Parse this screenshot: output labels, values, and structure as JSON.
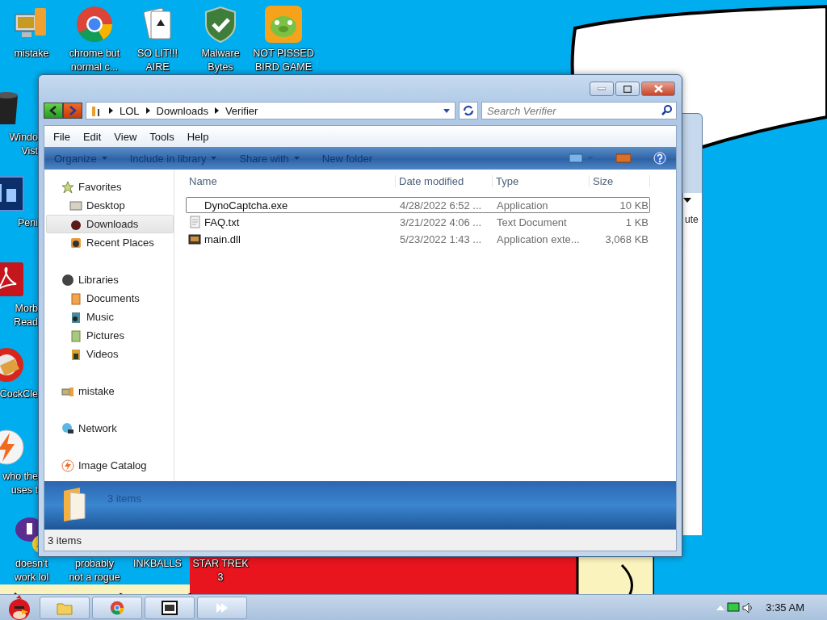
{
  "desktop_icons": [
    {
      "kind": "computer",
      "lines": [
        "mistake"
      ]
    },
    {
      "kind": "chrome",
      "lines": [
        "chrome but",
        "normal c..."
      ]
    },
    {
      "kind": "cards",
      "lines": [
        "SO LIT!!!",
        "AIRE"
      ]
    },
    {
      "kind": "shield",
      "lines": [
        "Malware",
        "Bytes"
      ]
    },
    {
      "kind": "pig",
      "lines": [
        "NOT PISSED",
        "BIRD GAME"
      ]
    },
    {
      "kind": "bin",
      "lines": [
        "Windo",
        "Vist"
      ]
    },
    {
      "kind": "ps",
      "lines": [
        "Peni"
      ]
    },
    {
      "kind": "pdf",
      "lines": [
        "Morb",
        "Read"
      ]
    },
    {
      "kind": "cleaner",
      "lines": [
        "CockCle"
      ]
    },
    {
      "kind": "bolt",
      "lines": [
        "who the",
        "uses t"
      ]
    },
    {
      "kind": "yahoo",
      "lines": [
        "doesn't",
        "work lol"
      ]
    },
    {
      "kind": "none",
      "lines": [
        "probably",
        "not a rogue"
      ]
    },
    {
      "kind": "none",
      "lines": [
        "INKBALLS"
      ]
    },
    {
      "kind": "none",
      "lines": [
        "STAR TREK",
        "3"
      ]
    }
  ],
  "background_window": {
    "text": "ute"
  },
  "window": {
    "address": {
      "crumbs": [
        "LOL",
        "Downloads",
        "Verifier"
      ]
    },
    "search": {
      "placeholder": "Search Verifier"
    },
    "menu": [
      "File",
      "Edit",
      "View",
      "Tools",
      "Help"
    ],
    "commands": [
      {
        "label": "Organize",
        "has_menu": true
      },
      {
        "label": "Include in library",
        "has_menu": true
      },
      {
        "label": "Share with",
        "has_menu": true
      },
      {
        "label": "New folder",
        "has_menu": false
      }
    ],
    "nav": [
      {
        "kind": "favorites",
        "label": "Favorites",
        "selected": false,
        "children": [
          {
            "kind": "desktop",
            "label": "Desktop",
            "selected": false
          },
          {
            "kind": "downloads",
            "label": "Downloads",
            "selected": true
          },
          {
            "kind": "recent",
            "label": "Recent Places",
            "selected": false
          }
        ]
      },
      {
        "kind": "libraries",
        "label": "Libraries",
        "selected": false,
        "children": [
          {
            "kind": "documents",
            "label": "Documents",
            "selected": false
          },
          {
            "kind": "music",
            "label": "Music",
            "selected": false
          },
          {
            "kind": "pictures",
            "label": "Pictures",
            "selected": false
          },
          {
            "kind": "videos",
            "label": "Videos",
            "selected": false
          }
        ]
      },
      {
        "kind": "computer",
        "label": "mistake",
        "selected": false
      },
      {
        "kind": "network",
        "label": "Network",
        "selected": false
      },
      {
        "kind": "catalog",
        "label": "Image Catalog",
        "selected": false
      }
    ],
    "columns": [
      "Name",
      "Date modified",
      "Type",
      "Size"
    ],
    "files": [
      {
        "kind": "exe",
        "name": "DynoCaptcha.exe",
        "date": "4/28/2022 6:52 ...",
        "type": "Application",
        "size": "10 KB",
        "focused": true
      },
      {
        "kind": "txt",
        "name": "FAQ.txt",
        "date": "3/21/2022 4:06 ...",
        "type": "Text Document",
        "size": "1 KB",
        "focused": false
      },
      {
        "kind": "dll",
        "name": "main.dll",
        "date": "5/23/2022 1:43 ...",
        "type": "Application exte...",
        "size": "3,068 KB",
        "focused": false
      }
    ],
    "details": {
      "text": "3 items"
    },
    "status": "3 items"
  },
  "taskbar": {
    "apps": [
      {
        "kind": "explorer"
      },
      {
        "kind": "chrome"
      },
      {
        "kind": "archive"
      },
      {
        "kind": "arrow"
      }
    ],
    "clock": "3:35 AM"
  }
}
